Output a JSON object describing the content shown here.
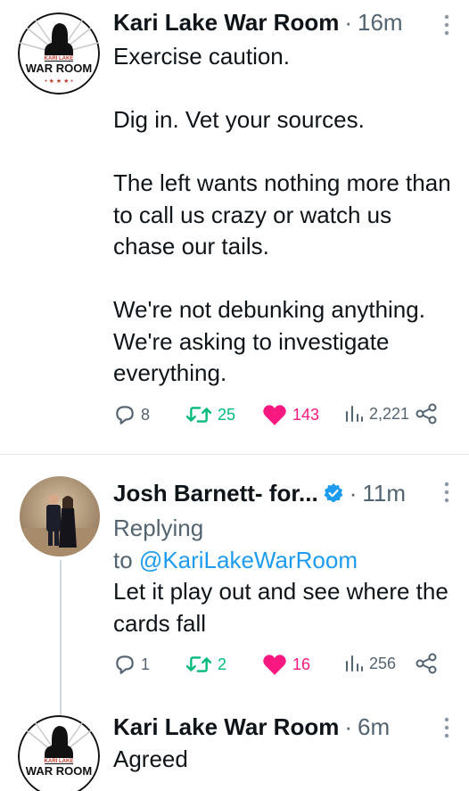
{
  "tweets": [
    {
      "author": "Kari Lake War Room",
      "time": "16m",
      "avatar_text": {
        "top": "KARI LAKE",
        "main": "WAR ROOM",
        "stars": "• ★ ★ ★ •"
      },
      "paragraphs": [
        "Exercise caution.",
        "Dig in. Vet your sources.",
        "The left wants nothing more than to call us crazy or watch us chase our tails.",
        "We're not debunking anything. We're asking to investigate everything."
      ],
      "stats": {
        "replies": "8",
        "retweets": "25",
        "likes": "143",
        "views": "2,221"
      }
    },
    {
      "author": "Josh Barnett- for...",
      "time": "11m",
      "verified": true,
      "replying_label": "Replying",
      "replying_to_prefix": "to",
      "replying_handle": "@KariLakeWarRoom",
      "text": "Let it play out and see where the cards fall",
      "stats": {
        "replies": "1",
        "retweets": "2",
        "likes": "16",
        "views": "256"
      }
    },
    {
      "author": "Kari Lake War Room",
      "time": "6m",
      "avatar_text": {
        "top": "KARI LAKE",
        "main": "WAR ROOM"
      },
      "text": "Agreed"
    }
  ],
  "separator": "·",
  "icons": {
    "reply": "reply-icon",
    "retweet": "retweet-icon",
    "like": "heart-icon",
    "views": "views-icon",
    "share": "share-icon",
    "more": "more-icon",
    "verified": "verified-badge-icon"
  },
  "colors": {
    "text": "#0f1419",
    "secondary": "#536471",
    "retweet_green": "#00ba7c",
    "like_red": "#f91880",
    "link_blue": "#1d9bf0"
  }
}
